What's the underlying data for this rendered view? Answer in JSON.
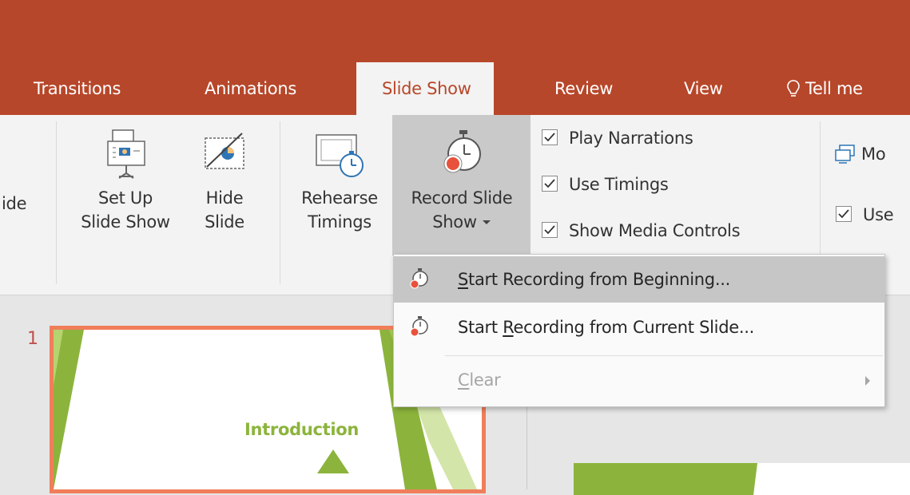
{
  "tabs": [
    "Transitions",
    "Animations",
    "Slide Show",
    "Review",
    "View"
  ],
  "tell_me": "Tell me",
  "ribbon": {
    "partial_left": "ide",
    "setup": {
      "line1": "Set Up",
      "line2": "Slide Show"
    },
    "hide": {
      "line1": "Hide",
      "line2": "Slide"
    },
    "rehearse": {
      "line1": "Rehearse",
      "line2": "Timings"
    },
    "record": {
      "line1": "Record Slide",
      "line2": "Show"
    },
    "checkboxes": [
      {
        "label": "Play Narrations",
        "checked": true
      },
      {
        "label": "Use Timings",
        "checked": true
      },
      {
        "label": "Show Media Controls",
        "checked": true
      }
    ],
    "monitor_partial": "Mo",
    "use_partial": "Use"
  },
  "menu": {
    "items": [
      {
        "pre": "",
        "u": "S",
        "post": "tart Recording from Beginning...",
        "state": "hover"
      },
      {
        "pre": "Start ",
        "u": "R",
        "post": "ecording from Current Slide...",
        "state": "normal"
      },
      {
        "pre": "",
        "u": "C",
        "post": "lear",
        "state": "disabled"
      }
    ]
  },
  "slides": {
    "number": "1",
    "title": "Introduction"
  },
  "colors": {
    "accent": "#b7472a",
    "thumb_border": "#f07e5a",
    "slide_green": "#8cb43c"
  }
}
